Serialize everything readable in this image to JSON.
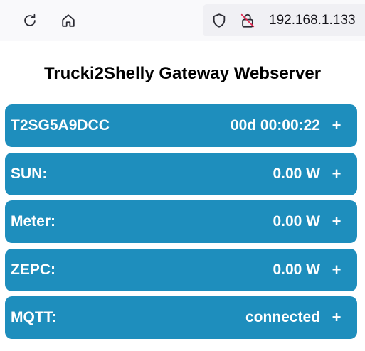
{
  "browser": {
    "url": "192.168.1.133",
    "icons": [
      "reload-icon",
      "home-icon",
      "shield-icon",
      "lock-insecure-icon"
    ]
  },
  "page": {
    "title": "Trucki2Shelly Gateway Webserver"
  },
  "cards": [
    {
      "label": "T2SG5A9DCC",
      "value": "00d 00:00:22",
      "toggle": "+"
    },
    {
      "label": "SUN:",
      "value": "0.00 W",
      "toggle": "+"
    },
    {
      "label": "Meter:",
      "value": "0.00 W",
      "toggle": "+"
    },
    {
      "label": "ZEPC:",
      "value": "0.00 W",
      "toggle": "+"
    },
    {
      "label": "MQTT:",
      "value": "connected",
      "toggle": "+"
    }
  ],
  "colors": {
    "card_background": "#1e8ebd",
    "card_text": "#ffffff",
    "toolbar_background": "#f9f9fb",
    "urlbar_background": "#f0f0f4",
    "insecure_red": "#e22850"
  }
}
